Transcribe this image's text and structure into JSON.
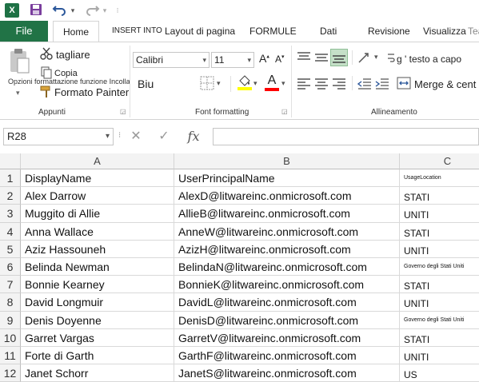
{
  "quick_access": {
    "app_logo": "X",
    "save_icon": "save-icon",
    "undo_icon": "undo-icon",
    "redo_icon": "redo-icon"
  },
  "tabs": {
    "file": "File",
    "items": [
      "Home",
      "INSERT INTO",
      "Layout di pagina",
      "FORMULE",
      "Dati",
      "Revisione",
      "Visualizza",
      "Tea"
    ]
  },
  "ribbon": {
    "clipboard": {
      "paste_label": "Opzioni formattazione funzione Incolla",
      "cut": "tagliare",
      "copy": "Copia",
      "format_painter": "Formato Painter",
      "group": "Appunti"
    },
    "font": {
      "name": "Calibri",
      "size": "11",
      "grow": "A",
      "shrink": "A",
      "biu": "Biu",
      "font_color_glyph": "A",
      "group": "Font formatting"
    },
    "alignment": {
      "wrap_text": "g ' testo a capo",
      "merge_center": "Merge & cent",
      "group": "Allineamento"
    }
  },
  "formula_bar": {
    "name_box": "R28",
    "cancel": "✕",
    "enter": "✓",
    "fx": "fx",
    "value": ""
  },
  "sheet": {
    "columns": [
      "A",
      "B",
      "C"
    ],
    "rows": [
      {
        "num": "1",
        "a": "DisplayName",
        "b": "UserPrincipalName",
        "c": "UsageLocation"
      },
      {
        "num": "2",
        "a": "Alex Darrow",
        "b": "AlexD@litwareinc.onmicrosoft.com",
        "c": "STATI"
      },
      {
        "num": "3",
        "a": "Muggito di Allie",
        "b": "AllieB@litwareinc.onmicrosoft.com",
        "c": "UNITI"
      },
      {
        "num": "4",
        "a": "Anna Wallace",
        "b": "AnneW@litwareinc.onmicrosoft.com",
        "c": "STATI"
      },
      {
        "num": "5",
        "a": "Aziz Hassouneh",
        "b": "AzizH@litwareinc.onmicrosoft.com",
        "c": "UNITI"
      },
      {
        "num": "6",
        "a": "Belinda Newman",
        "b": "BelindaN@litwareinc.onmicrosoft.com",
        "c": "Governo degli Stati Uniti"
      },
      {
        "num": "7",
        "a": "Bonnie Kearney",
        "b": "BonnieK@litwareinc.onmicrosoft.com",
        "c": "STATI"
      },
      {
        "num": "8",
        "a": "David Longmuir",
        "b": "DavidL@litwareinc.onmicrosoft.com",
        "c": "UNITI"
      },
      {
        "num": "9",
        "a": "Denis Doyenne",
        "b": "DenisD@litwareinc.onmicrosoft.com",
        "c": "Governo degli Stati Uniti"
      },
      {
        "num": "10",
        "a": "Garret Vargas",
        "b": "GarretV@litwareinc.onmicrosoft.com",
        "c": "STATI"
      },
      {
        "num": "11",
        "a": "Forte di Garth",
        "b": "GarthF@litwareinc.onmicrosoft.com",
        "c": "UNITI"
      },
      {
        "num": "12",
        "a": "Janet Schorr",
        "b": "JanetS@litwareinc.onmicrosoft.com",
        "c": "US"
      }
    ]
  },
  "colors": {
    "excel_green": "#217346",
    "highlight_yellow": "#ffff00",
    "font_red": "#ff0000"
  }
}
